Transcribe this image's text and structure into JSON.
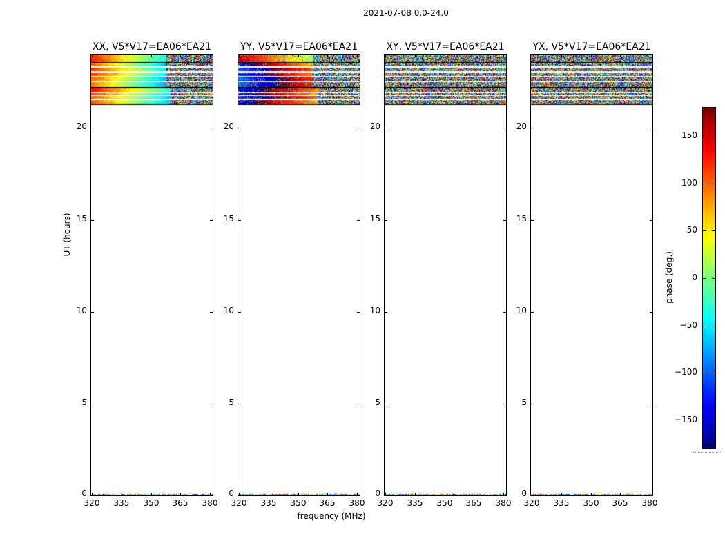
{
  "chart_data": {
    "type": "heatmap",
    "title": "2021-07-08 0.0-24.0",
    "xlabel": "frequency (MHz)",
    "ylabel": "UT (hours)",
    "xlim": [
      319.5,
      381.5
    ],
    "ylim": [
      0,
      24
    ],
    "xticks": [
      320,
      335,
      350,
      365,
      380
    ],
    "yticks": [
      0,
      5,
      10,
      15,
      20
    ],
    "colorbar": {
      "label": "phase (deg.)",
      "cmap": "jet",
      "vmin": -180,
      "vmax": 180,
      "ticks": [
        150,
        100,
        50,
        0,
        -50,
        -100,
        -150
      ]
    },
    "panels": [
      {
        "id": "XX",
        "title": "XX, V5*V17=EA06*EA21",
        "pattern": "smooth-gradient-then-noise",
        "phase_left_deg": 112,
        "phase_right_deg": -56,
        "description": "orange to yellow to green to cyan gradient across frequency, noisy blue interference pattern above ~358 MHz"
      },
      {
        "id": "YY",
        "title": "YY, V5*V17=EA06*EA21",
        "pattern": "wrapped-gradient-then-noise",
        "phase_left_deg": -115,
        "phase_right_deg": -265,
        "description": "dark blue at low frequency wrapping through dark red/red/orange, noisy pattern above ~358 MHz"
      },
      {
        "id": "XY",
        "title": "XY, V5*V17=EA06*EA21",
        "pattern": "noise",
        "description": "random multicolor phase noise across the whole band"
      },
      {
        "id": "YX",
        "title": "YX, V5*V17=EA06*EA21",
        "pattern": "noise",
        "description": "random multicolor phase noise across the whole band"
      }
    ],
    "scans": {
      "noise_start_frac_upper": 0.61,
      "noise_start_frac_lower": 0.65,
      "ut_rows": [
        {
          "ut0": 23.96,
          "ut1": 23.59,
          "kind": "scan"
        },
        {
          "ut0": 23.59,
          "ut1": 23.55,
          "kind": "divider"
        },
        {
          "ut0": 23.55,
          "ut1": 23.36,
          "kind": "scan"
        },
        {
          "ut0": 23.29,
          "ut1": 23.1,
          "kind": "scan"
        },
        {
          "ut0": 22.99,
          "ut1": 22.84,
          "kind": "scan"
        },
        {
          "ut0": 22.8,
          "ut1": 22.54,
          "kind": "scan"
        },
        {
          "ut0": 22.5,
          "ut1": 22.23,
          "kind": "scan"
        },
        {
          "ut0": 22.23,
          "ut1": 22.16,
          "kind": "divider"
        },
        {
          "ut0": 22.16,
          "ut1": 21.93,
          "kind": "scan"
        },
        {
          "ut0": 21.9,
          "ut1": 21.78,
          "kind": "scan"
        },
        {
          "ut0": 21.75,
          "ut1": 21.6,
          "kind": "scan"
        },
        {
          "ut0": 21.52,
          "ut1": 21.3,
          "kind": "scan"
        },
        {
          "ut0": 21.3,
          "ut1": 21.26,
          "kind": "divider"
        },
        {
          "ut0": 0.08,
          "ut1": 0.0,
          "kind": "scan0"
        }
      ]
    }
  }
}
